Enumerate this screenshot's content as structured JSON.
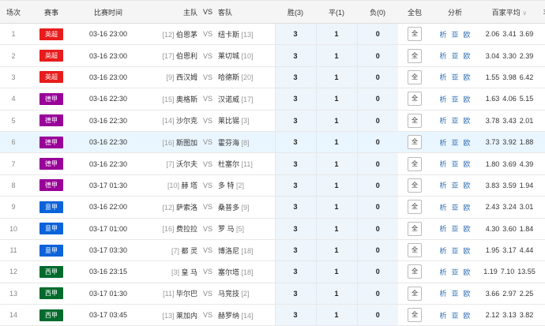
{
  "headers": {
    "round": "场次",
    "league": "赛事",
    "time": "比赛时间",
    "home": "主队",
    "vs": "VS",
    "away": "客队",
    "win": "胜(3)",
    "draw": "平(1)",
    "lose": "负(0)",
    "full": "全包",
    "analysis": "分析",
    "avg": "百家平均",
    "extra": "丰"
  },
  "colors": {
    "yingchao": "#e81c1c",
    "dejia": "#990099",
    "yijia": "#0b63d9",
    "xijia": "#006b2d"
  },
  "rows": [
    {
      "n": "1",
      "league": "英超",
      "color": "#e81c1c",
      "time": "03-16 23:00",
      "hrank": "[12]",
      "home": "伯恩茅",
      "away": "纽卡斯",
      "arank": "[13]",
      "w": "3",
      "d": "1",
      "l": "0",
      "full": "全",
      "a1": "析",
      "a2": "亚",
      "a3": "欧",
      "o1": "2.06",
      "o2": "3.41",
      "o3": "3.69"
    },
    {
      "n": "2",
      "league": "英超",
      "color": "#e81c1c",
      "time": "03-16 23:00",
      "hrank": "[17]",
      "home": "伯恩利",
      "away": "莱切城",
      "arank": "[10]",
      "w": "3",
      "d": "1",
      "l": "0",
      "full": "全",
      "a1": "析",
      "a2": "亚",
      "a3": "欧",
      "o1": "3.04",
      "o2": "3.30",
      "o3": "2.39"
    },
    {
      "n": "3",
      "league": "英超",
      "color": "#e81c1c",
      "time": "03-16 23:00",
      "hrank": "[9]",
      "home": "西汉姆",
      "away": "哈德斯",
      "arank": "[20]",
      "w": "3",
      "d": "1",
      "l": "0",
      "full": "全",
      "a1": "析",
      "a2": "亚",
      "a3": "欧",
      "o1": "1.55",
      "o2": "3.98",
      "o3": "6.42"
    },
    {
      "n": "4",
      "league": "德甲",
      "color": "#990099",
      "time": "03-16 22:30",
      "hrank": "[15]",
      "home": "奥格斯",
      "away": "汉诺威",
      "arank": "[17]",
      "w": "3",
      "d": "1",
      "l": "0",
      "full": "全",
      "a1": "析",
      "a2": "亚",
      "a3": "欧",
      "o1": "1.63",
      "o2": "4.06",
      "o3": "5.15"
    },
    {
      "n": "5",
      "league": "德甲",
      "color": "#990099",
      "time": "03-16 22:30",
      "hrank": "[14]",
      "home": "沙尔克",
      "away": "莱比锡",
      "arank": "[3]",
      "w": "3",
      "d": "1",
      "l": "0",
      "full": "全",
      "a1": "析",
      "a2": "亚",
      "a3": "欧",
      "o1": "3.78",
      "o2": "3.43",
      "o3": "2.01"
    },
    {
      "n": "6",
      "league": "德甲",
      "color": "#990099",
      "time": "03-16 22:30",
      "hrank": "[16]",
      "home": "斯图加",
      "away": "霍芬海",
      "arank": "[8]",
      "w": "3",
      "d": "1",
      "l": "0",
      "full": "全",
      "a1": "析",
      "a2": "亚",
      "a3": "欧",
      "o1": "3.73",
      "o2": "3.92",
      "o3": "1.88"
    },
    {
      "n": "7",
      "league": "德甲",
      "color": "#990099",
      "time": "03-16 22:30",
      "hrank": "[7]",
      "home": "沃尔夫",
      "away": "杜塞尔",
      "arank": "[11]",
      "w": "3",
      "d": "1",
      "l": "0",
      "full": "全",
      "a1": "析",
      "a2": "亚",
      "a3": "欧",
      "o1": "1.80",
      "o2": "3.69",
      "o3": "4.39"
    },
    {
      "n": "8",
      "league": "德甲",
      "color": "#990099",
      "time": "03-17 01:30",
      "hrank": "[10]",
      "home": "赫 塔",
      "away": "多 特",
      "arank": "[2]",
      "w": "3",
      "d": "1",
      "l": "0",
      "full": "全",
      "a1": "析",
      "a2": "亚",
      "a3": "欧",
      "o1": "3.83",
      "o2": "3.59",
      "o3": "1.94"
    },
    {
      "n": "9",
      "league": "意甲",
      "color": "#0b63d9",
      "time": "03-16 22:00",
      "hrank": "[12]",
      "home": "萨索洛",
      "away": "桑普多",
      "arank": "[9]",
      "w": "3",
      "d": "1",
      "l": "0",
      "full": "全",
      "a1": "析",
      "a2": "亚",
      "a3": "欧",
      "o1": "2.43",
      "o2": "3.24",
      "o3": "3.01"
    },
    {
      "n": "10",
      "league": "意甲",
      "color": "#0b63d9",
      "time": "03-17 01:00",
      "hrank": "[16]",
      "home": "费拉拉",
      "away": "罗 马",
      "arank": "[5]",
      "w": "3",
      "d": "1",
      "l": "0",
      "full": "全",
      "a1": "析",
      "a2": "亚",
      "a3": "欧",
      "o1": "4.30",
      "o2": "3.60",
      "o3": "1.84"
    },
    {
      "n": "11",
      "league": "意甲",
      "color": "#0b63d9",
      "time": "03-17 03:30",
      "hrank": "[7]",
      "home": "都 灵",
      "away": "博洛尼",
      "arank": "[18]",
      "w": "3",
      "d": "1",
      "l": "0",
      "full": "全",
      "a1": "析",
      "a2": "亚",
      "a3": "欧",
      "o1": "1.95",
      "o2": "3.17",
      "o3": "4.44"
    },
    {
      "n": "12",
      "league": "西甲",
      "color": "#006b2d",
      "time": "03-16 23:15",
      "hrank": "[3]",
      "home": "皇 马",
      "away": "塞尔塔",
      "arank": "[18]",
      "w": "3",
      "d": "1",
      "l": "0",
      "full": "全",
      "a1": "析",
      "a2": "亚",
      "a3": "欧",
      "o1": "1.19",
      "o2": "7.10",
      "o3": "13.55"
    },
    {
      "n": "13",
      "league": "西甲",
      "color": "#006b2d",
      "time": "03-17 01:30",
      "hrank": "[11]",
      "home": "毕尔巴",
      "away": "马竞技",
      "arank": "[2]",
      "w": "3",
      "d": "1",
      "l": "0",
      "full": "全",
      "a1": "析",
      "a2": "亚",
      "a3": "欧",
      "o1": "3.66",
      "o2": "2.97",
      "o3": "2.25"
    },
    {
      "n": "14",
      "league": "西甲",
      "color": "#006b2d",
      "time": "03-17 03:45",
      "hrank": "[13]",
      "home": "莱加内",
      "away": "赫罗纳",
      "arank": "[14]",
      "w": "3",
      "d": "1",
      "l": "0",
      "full": "全",
      "a1": "析",
      "a2": "亚",
      "a3": "欧",
      "o1": "2.12",
      "o2": "3.13",
      "o3": "3.82"
    }
  ]
}
